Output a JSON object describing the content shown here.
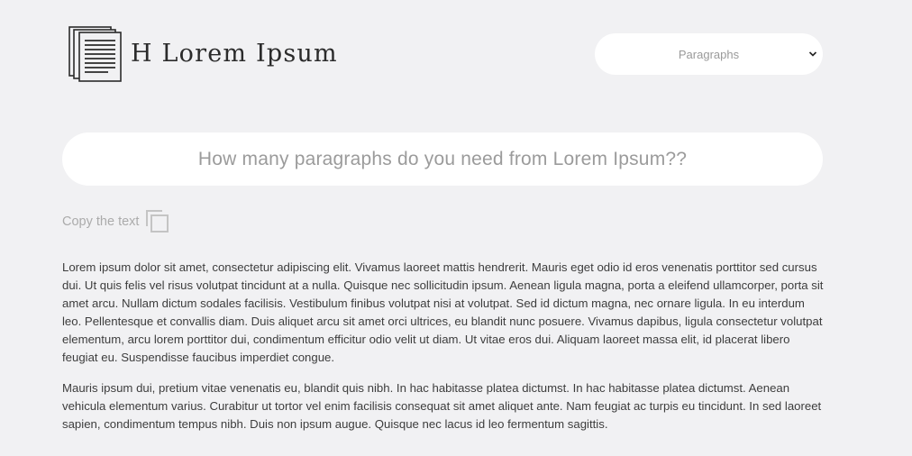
{
  "header": {
    "brand_title": "H Lorem Ipsum",
    "logo_icon": "document-stack-icon",
    "select": {
      "value": "Paragraphs",
      "icon": "chevron-down-icon"
    }
  },
  "question": {
    "text": "How many paragraphs do you need from Lorem Ipsum??"
  },
  "copy": {
    "label": "Copy the text",
    "icon": "copy-icon"
  },
  "paragraphs": [
    "Lorem ipsum dolor sit amet, consectetur adipiscing elit. Vivamus laoreet mattis hendrerit. Mauris eget odio id eros venenatis porttitor sed cursus dui. Ut quis felis vel risus volutpat tincidunt at a nulla. Quisque nec sollicitudin ipsum. Aenean ligula magna, porta a eleifend ullamcorper, porta sit amet arcu. Nullam dictum sodales facilisis. Vestibulum finibus volutpat nisi at volutpat. Sed id dictum magna, nec ornare ligula. In eu interdum leo. Pellentesque et convallis diam. Duis aliquet arcu sit amet orci ultrices, eu blandit nunc posuere. Vivamus dapibus, ligula consectetur volutpat elementum, arcu lorem porttitor dui, condimentum efficitur odio velit ut diam. Ut vitae eros dui. Aliquam laoreet massa elit, id placerat libero feugiat eu. Suspendisse faucibus imperdiet congue.",
    "Mauris ipsum dui, pretium vitae venenatis eu, blandit quis nibh. In hac habitasse platea dictumst. In hac habitasse platea dictumst. Aenean vehicula elementum varius. Curabitur ut tortor vel enim facilisis consequat sit amet aliquet ante. Nam feugiat ac turpis eu tincidunt. In sed laoreet sapien, condimentum tempus nibh. Duis non ipsum augue. Quisque nec lacus id leo fermentum sagittis."
  ]
}
